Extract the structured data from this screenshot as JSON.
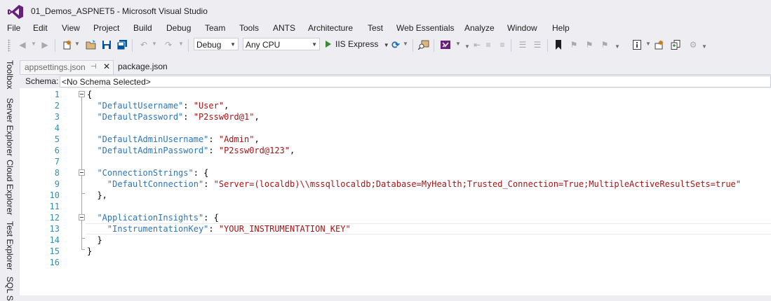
{
  "window": {
    "title": "01_Demos_ASPNET5 - Microsoft Visual Studio"
  },
  "menu": [
    "File",
    "Edit",
    "View",
    "Project",
    "Build",
    "Debug",
    "Team",
    "Tools",
    "ANTS",
    "Architecture",
    "Test",
    "Web Essentials",
    "Analyze",
    "Window",
    "Help"
  ],
  "toolbar": {
    "configuration": "Debug",
    "platform": "Any CPU",
    "run_target": "IIS Express"
  },
  "side_tabs": [
    "Toolbox",
    "Server Explorer",
    "Cloud Explorer",
    "Test Explorer",
    "SQL S"
  ],
  "tabs": {
    "active": "appsettings.json",
    "inactive": "package.json"
  },
  "schema": {
    "label": "Schema:",
    "value": "<No Schema Selected>"
  },
  "editor": {
    "lines": [
      {
        "n": "1",
        "segs": [
          [
            "p",
            "{"
          ]
        ]
      },
      {
        "n": "2",
        "segs": [
          [
            "p",
            "  "
          ],
          [
            "k",
            "\"DefaultUsername\""
          ],
          [
            "p",
            ": "
          ],
          [
            "s",
            "\"User\""
          ],
          [
            "p",
            ","
          ]
        ]
      },
      {
        "n": "3",
        "segs": [
          [
            "p",
            "  "
          ],
          [
            "k",
            "\"DefaultPassword\""
          ],
          [
            "p",
            ": "
          ],
          [
            "s",
            "\"P2ssw0rd@1\""
          ],
          [
            "p",
            ","
          ]
        ]
      },
      {
        "n": "4",
        "segs": []
      },
      {
        "n": "5",
        "segs": [
          [
            "p",
            "  "
          ],
          [
            "k",
            "\"DefaultAdminUsername\""
          ],
          [
            "p",
            ": "
          ],
          [
            "s",
            "\"Admin\""
          ],
          [
            "p",
            ","
          ]
        ]
      },
      {
        "n": "6",
        "segs": [
          [
            "p",
            "  "
          ],
          [
            "k",
            "\"DefaultAdminPassword\""
          ],
          [
            "p",
            ": "
          ],
          [
            "s",
            "\"P2ssw0rd@123\""
          ],
          [
            "p",
            ","
          ]
        ]
      },
      {
        "n": "7",
        "segs": []
      },
      {
        "n": "8",
        "segs": [
          [
            "p",
            "  "
          ],
          [
            "k",
            "\"ConnectionStrings\""
          ],
          [
            "p",
            ": {"
          ]
        ]
      },
      {
        "n": "9",
        "segs": [
          [
            "p",
            "    "
          ],
          [
            "k",
            "\"DefaultConnection\""
          ],
          [
            "p",
            ": "
          ],
          [
            "s",
            "\"Server=(localdb)\\\\mssqllocaldb;Database=MyHealth;Trusted_Connection=True;MultipleActiveResultSets=true\""
          ]
        ]
      },
      {
        "n": "10",
        "segs": [
          [
            "p",
            "  },"
          ]
        ]
      },
      {
        "n": "11",
        "segs": []
      },
      {
        "n": "12",
        "segs": [
          [
            "p",
            "  "
          ],
          [
            "k",
            "\"ApplicationInsights\""
          ],
          [
            "p",
            ": {"
          ]
        ]
      },
      {
        "n": "13",
        "segs": [
          [
            "p",
            "    "
          ],
          [
            "k",
            "\"InstrumentationKey\""
          ],
          [
            "p",
            ": "
          ],
          [
            "s",
            "\"YOUR_INSTRUMENTATION_KEY\""
          ]
        ]
      },
      {
        "n": "14",
        "segs": [
          [
            "p",
            "  }"
          ]
        ]
      },
      {
        "n": "15",
        "segs": [
          [
            "p",
            "}"
          ]
        ]
      },
      {
        "n": "16",
        "segs": []
      }
    ]
  },
  "colors": {
    "key": "#2e75b6",
    "string": "#a31515",
    "line_number": "#2b91af",
    "run": "#388a34",
    "vs_purple": "#68217a"
  }
}
